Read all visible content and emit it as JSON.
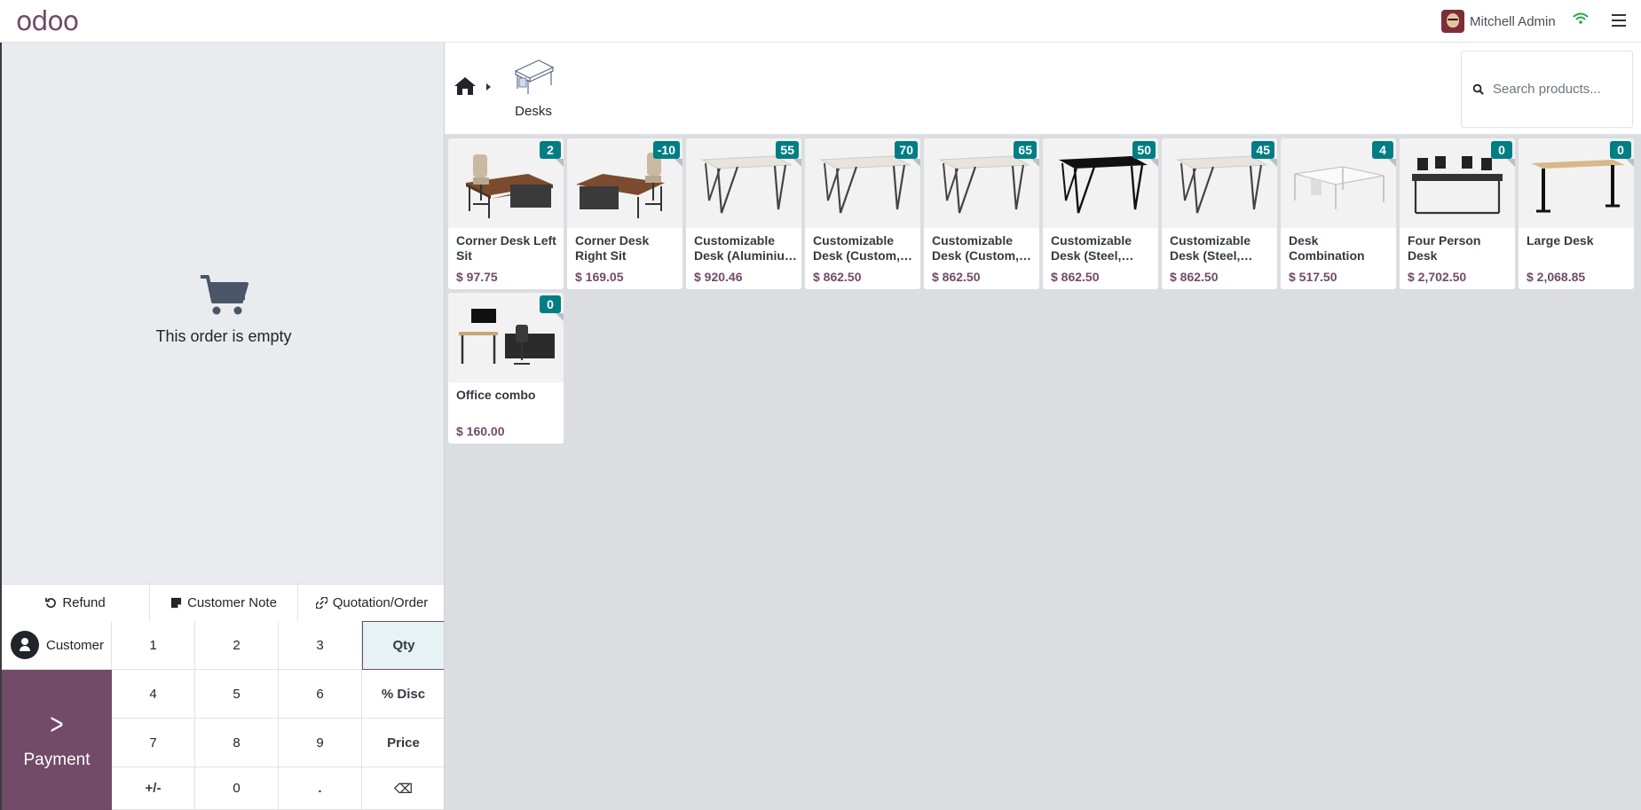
{
  "header": {
    "logo": "odoo",
    "user_name": "Mitchell Admin",
    "wifi_icon": "wifi-icon",
    "menu_icon": "hamburger-icon"
  },
  "order": {
    "empty_text": "This order is empty"
  },
  "actions": {
    "refund": "Refund",
    "customer_note": "Customer Note",
    "quotation": "Quotation/Order"
  },
  "pad": {
    "customer": "Customer",
    "payment": "Payment",
    "keys": [
      "1",
      "2",
      "3",
      "Qty",
      "4",
      "5",
      "6",
      "% Disc",
      "7",
      "8",
      "9",
      "Price",
      "+/-",
      "0",
      ".",
      "⌫"
    ]
  },
  "breadcrumb": {
    "category": "Desks"
  },
  "search": {
    "placeholder": "Search products..."
  },
  "colors": {
    "brand": "#714b67",
    "badge": "#017e84"
  },
  "products": [
    {
      "name": "Corner Desk Left Sit",
      "price": "$ 97.75",
      "stock": "2",
      "img": "corner-left"
    },
    {
      "name": "Corner Desk Right Sit",
      "price": "$ 169.05",
      "stock": "-10",
      "img": "corner-right"
    },
    {
      "name": "Customizable Desk (Aluminiu…",
      "price": "$ 920.46",
      "stock": "55",
      "img": "table-white"
    },
    {
      "name": "Customizable Desk (Custom,…",
      "price": "$ 862.50",
      "stock": "70",
      "img": "table-white"
    },
    {
      "name": "Customizable Desk (Custom,…",
      "price": "$ 862.50",
      "stock": "65",
      "img": "table-white"
    },
    {
      "name": "Customizable Desk (Steel,…",
      "price": "$ 862.50",
      "stock": "50",
      "img": "table-black"
    },
    {
      "name": "Customizable Desk (Steel,…",
      "price": "$ 862.50",
      "stock": "45",
      "img": "table-white"
    },
    {
      "name": "Desk Combination",
      "price": "$ 517.50",
      "stock": "4",
      "img": "combination"
    },
    {
      "name": "Four Person Desk",
      "price": "$ 2,702.50",
      "stock": "0",
      "img": "four-person"
    },
    {
      "name": "Large Desk",
      "price": "$ 2,068.85",
      "stock": "0",
      "img": "large-desk"
    },
    {
      "name": "Office combo",
      "price": "$ 160.00",
      "stock": "0",
      "img": "office-combo"
    }
  ]
}
